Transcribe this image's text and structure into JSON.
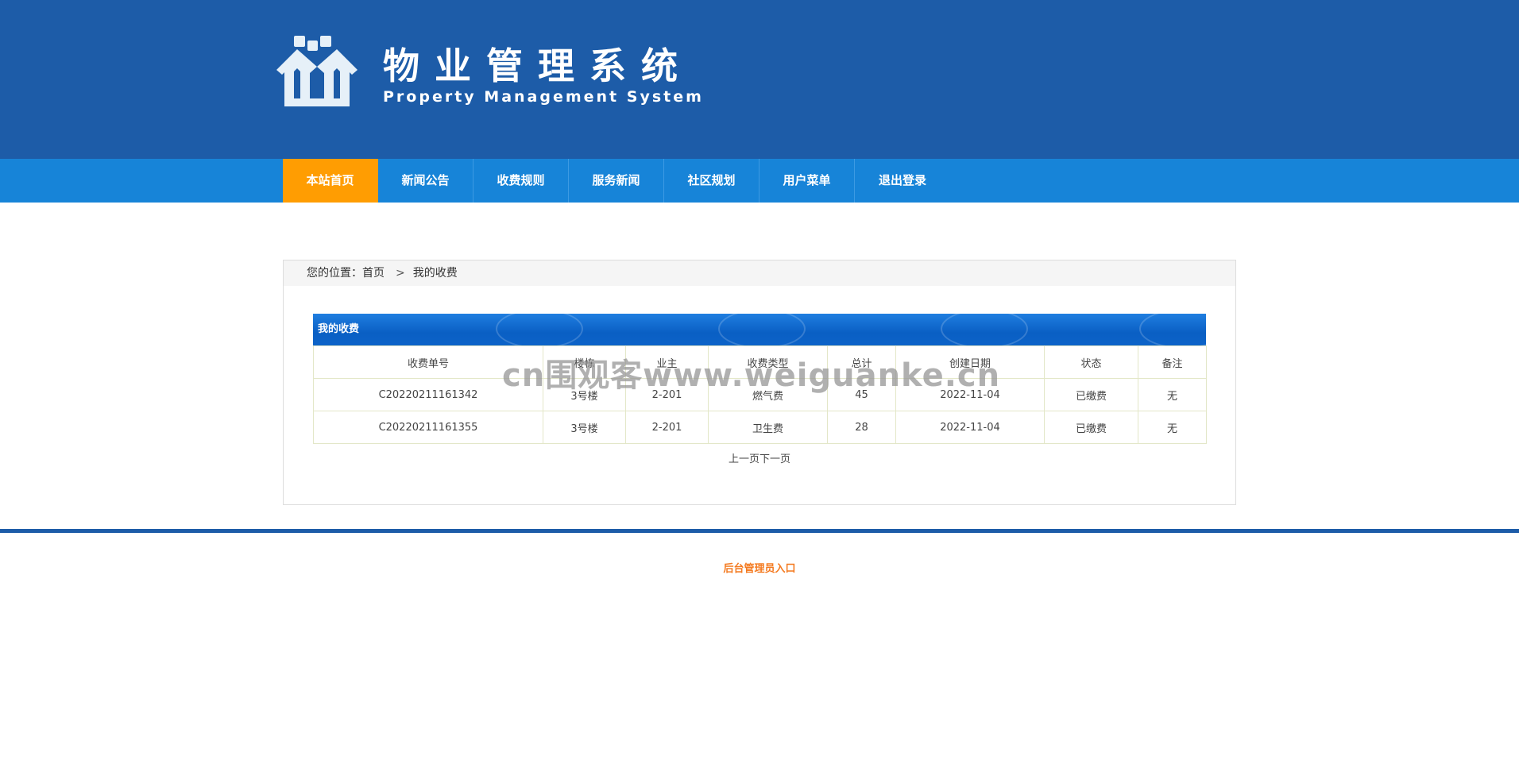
{
  "header": {
    "logo_icon": "house-people-logo",
    "title": "物业管理系统",
    "subtitle": "Property Management System",
    "colors": {
      "header_bg": "#1d5ca8",
      "nav_bg": "#1784d8",
      "nav_active": "#ff9d02"
    }
  },
  "nav": {
    "items": [
      {
        "label": "本站首页",
        "active": true
      },
      {
        "label": "新闻公告"
      },
      {
        "label": "收费规则"
      },
      {
        "label": "服务新闻"
      },
      {
        "label": "社区规划"
      },
      {
        "label": "用户菜单"
      },
      {
        "label": "退出登录"
      }
    ]
  },
  "breadcrumb": {
    "prefix": "您的位置：",
    "home": "首页",
    "separator": ">",
    "current": "我的收费"
  },
  "panel": {
    "title": "我的收费",
    "columns": [
      "收费单号",
      "楼栋",
      "业主",
      "收费类型",
      "总计",
      "创建日期",
      "状态",
      "备注"
    ],
    "rows": [
      [
        "C20220211161342",
        "3号楼",
        "2-201",
        "燃气费",
        "45",
        "2022-11-04",
        "已缴费",
        "无"
      ],
      [
        "C20220211161355",
        "3号楼",
        "2-201",
        "卫生费",
        "28",
        "2022-11-04",
        "已缴费",
        "无"
      ]
    ]
  },
  "pager": {
    "prev": "上一页",
    "next": "下一页"
  },
  "watermark": "cn围观客www.weiguanke.cn",
  "footer": {
    "admin_link": "后台管理员入口"
  }
}
